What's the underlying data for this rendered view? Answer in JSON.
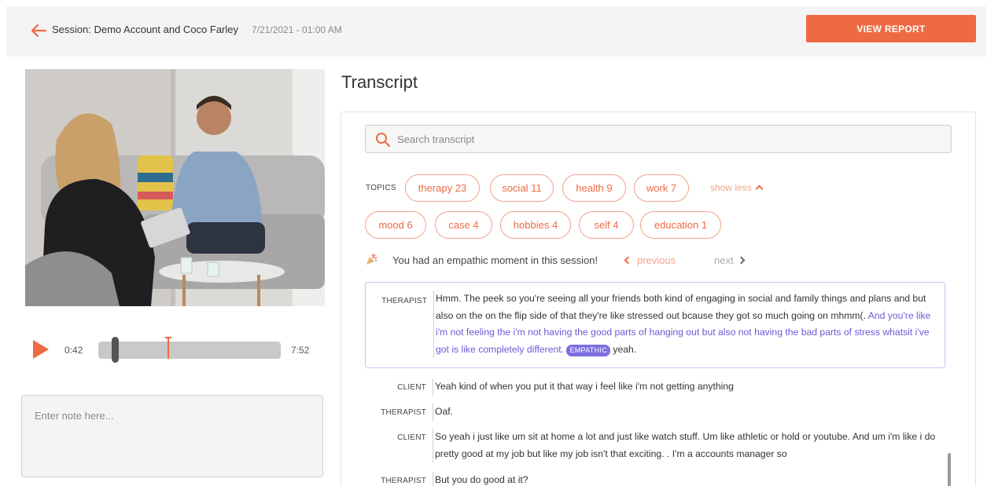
{
  "header": {
    "session_title": "Session: Demo Account and Coco Farley",
    "session_date": "7/21/2021 - 01:00 AM",
    "view_report_label": "VIEW REPORT"
  },
  "player": {
    "current_time": "0:42",
    "total_time": "7:52",
    "progress": 0.089
  },
  "note": {
    "placeholder": "Enter note here..."
  },
  "transcript": {
    "heading": "Transcript",
    "search_placeholder": "Search transcript",
    "topics_label": "TOPICS",
    "topics": [
      {
        "label": "therapy 23"
      },
      {
        "label": "social 11"
      },
      {
        "label": "health 9"
      },
      {
        "label": "work 7"
      },
      {
        "label": "mood 6"
      },
      {
        "label": "case 4"
      },
      {
        "label": "hobbies 4"
      },
      {
        "label": "self 4"
      },
      {
        "label": "education 1"
      }
    ],
    "show_less_label": "show less",
    "empathic_message": "You had an empathic moment in this session!",
    "previous_label": "previous",
    "next_label": "next",
    "entries": [
      {
        "speaker": "THERAPIST",
        "text_before": "Hmm. The peek so you're seeing all your friends both kind of engaging in social and family things and plans and but also on the on the flip side of that they're like stressed out bcause they got so much going on mhmm(.",
        "text_empathic": " And you're like i'm not feeling the i'm not having the good parts of hanging out but also not having the bad parts of stress whatsit i've got is like completely different.",
        "tag": "EMPATHIC",
        "text_after": " yeah."
      },
      {
        "speaker": "CLIENT",
        "text": "Yeah kind of when you put it that way i feel like i'm not getting anything"
      },
      {
        "speaker": "THERAPIST",
        "text": "Oaf."
      },
      {
        "speaker": "CLIENT",
        "text": "So yeah i just like um sit at home a lot and just like watch stuff. Um like athletic or hold or youtube. And um i'm like i do pretty good at my job but like my job isn't that exciting. . I'm a accounts manager so"
      },
      {
        "speaker": "THERAPIST",
        "text": "But you do good at it?"
      }
    ]
  },
  "colors": {
    "accent": "#ee6a43",
    "empathic": "#6b5ad6",
    "empathic_tag": "#7d6fe0"
  },
  "icons": [
    "back-arrow-icon",
    "play-icon",
    "search-icon",
    "party-popper-icon",
    "chevron-up-icon",
    "chevron-left-icon",
    "chevron-right-icon"
  ]
}
